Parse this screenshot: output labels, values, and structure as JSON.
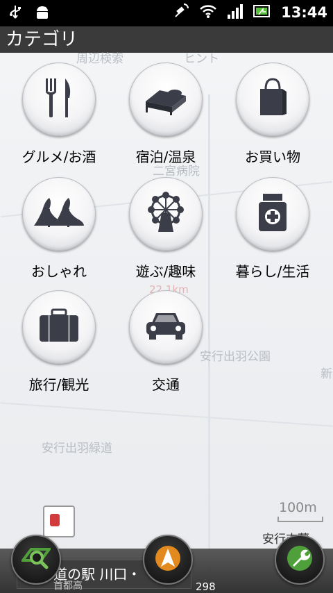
{
  "status_bar": {
    "time": "13:44",
    "icons": [
      "usb-icon",
      "android-debug-icon",
      "gps-icon",
      "wifi-icon",
      "signal-icon",
      "battery-icon"
    ]
  },
  "title": "カテゴリ",
  "categories": [
    {
      "label": "グルメ/お酒",
      "icon": "fork-knife-icon"
    },
    {
      "label": "宿泊/温泉",
      "icon": "bed-icon"
    },
    {
      "label": "お買い物",
      "icon": "shopping-bag-icon"
    },
    {
      "label": "おしゃれ",
      "icon": "high-heels-icon"
    },
    {
      "label": "遊ぶ/趣味",
      "icon": "ferris-wheel-icon"
    },
    {
      "label": "暮らし/生活",
      "icon": "medicine-icon"
    },
    {
      "label": "旅行/観光",
      "icon": "suitcase-icon"
    },
    {
      "label": "交通",
      "icon": "car-icon"
    }
  ],
  "map": {
    "labels": [
      "周辺検索",
      "ヒント",
      "二宮病院",
      "安行出羽公園",
      "安行出羽緑道",
      "新",
      "安行吉蔵"
    ],
    "distance": "22.1km",
    "scale": "100m",
    "road_name": "道の駅 川口・",
    "road_sub": "首都高",
    "route_number": "298"
  },
  "colors": {
    "icon_dark": "#3b3e48",
    "green_button": "#4fa03a",
    "orange_button": "#e28a1e"
  }
}
